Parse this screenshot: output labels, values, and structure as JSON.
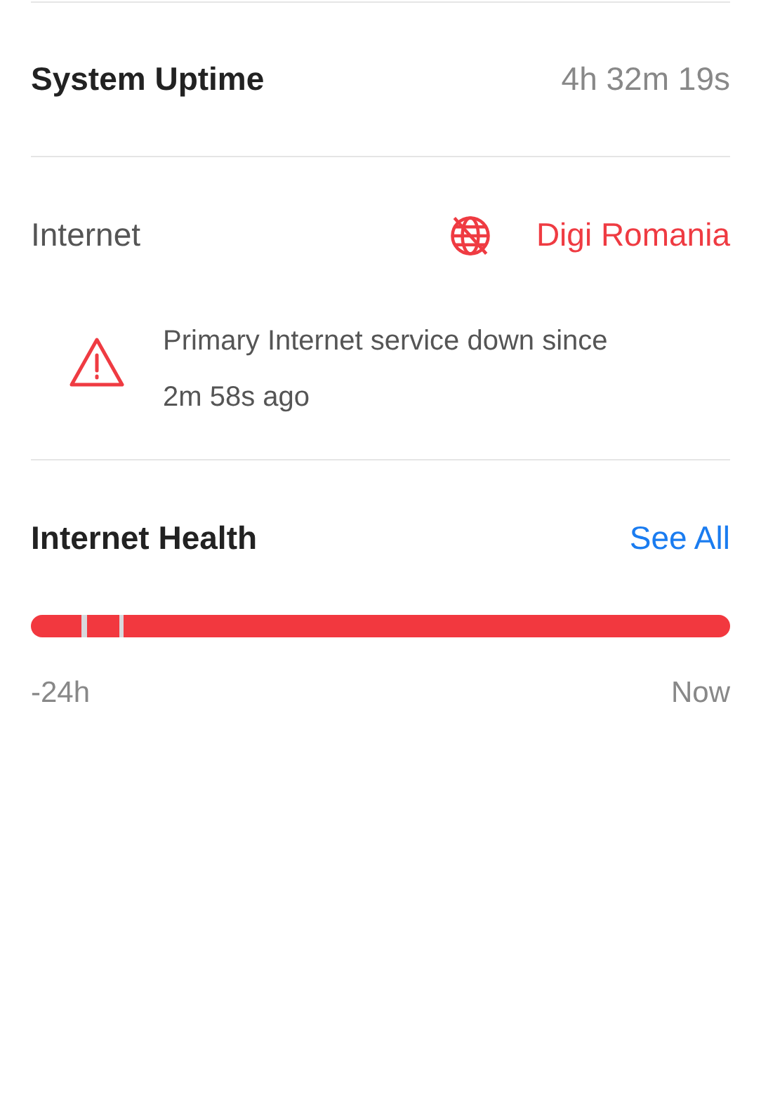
{
  "uptime": {
    "label": "System Uptime",
    "value": "4h 32m 19s"
  },
  "internet": {
    "label": "Internet",
    "provider": "Digi Romania",
    "online": false
  },
  "alert": {
    "message": "Primary Internet service down since 2m 58s ago"
  },
  "health": {
    "title": "Internet Health",
    "link": "See All",
    "start_label": "-24h",
    "end_label": "Now"
  }
}
